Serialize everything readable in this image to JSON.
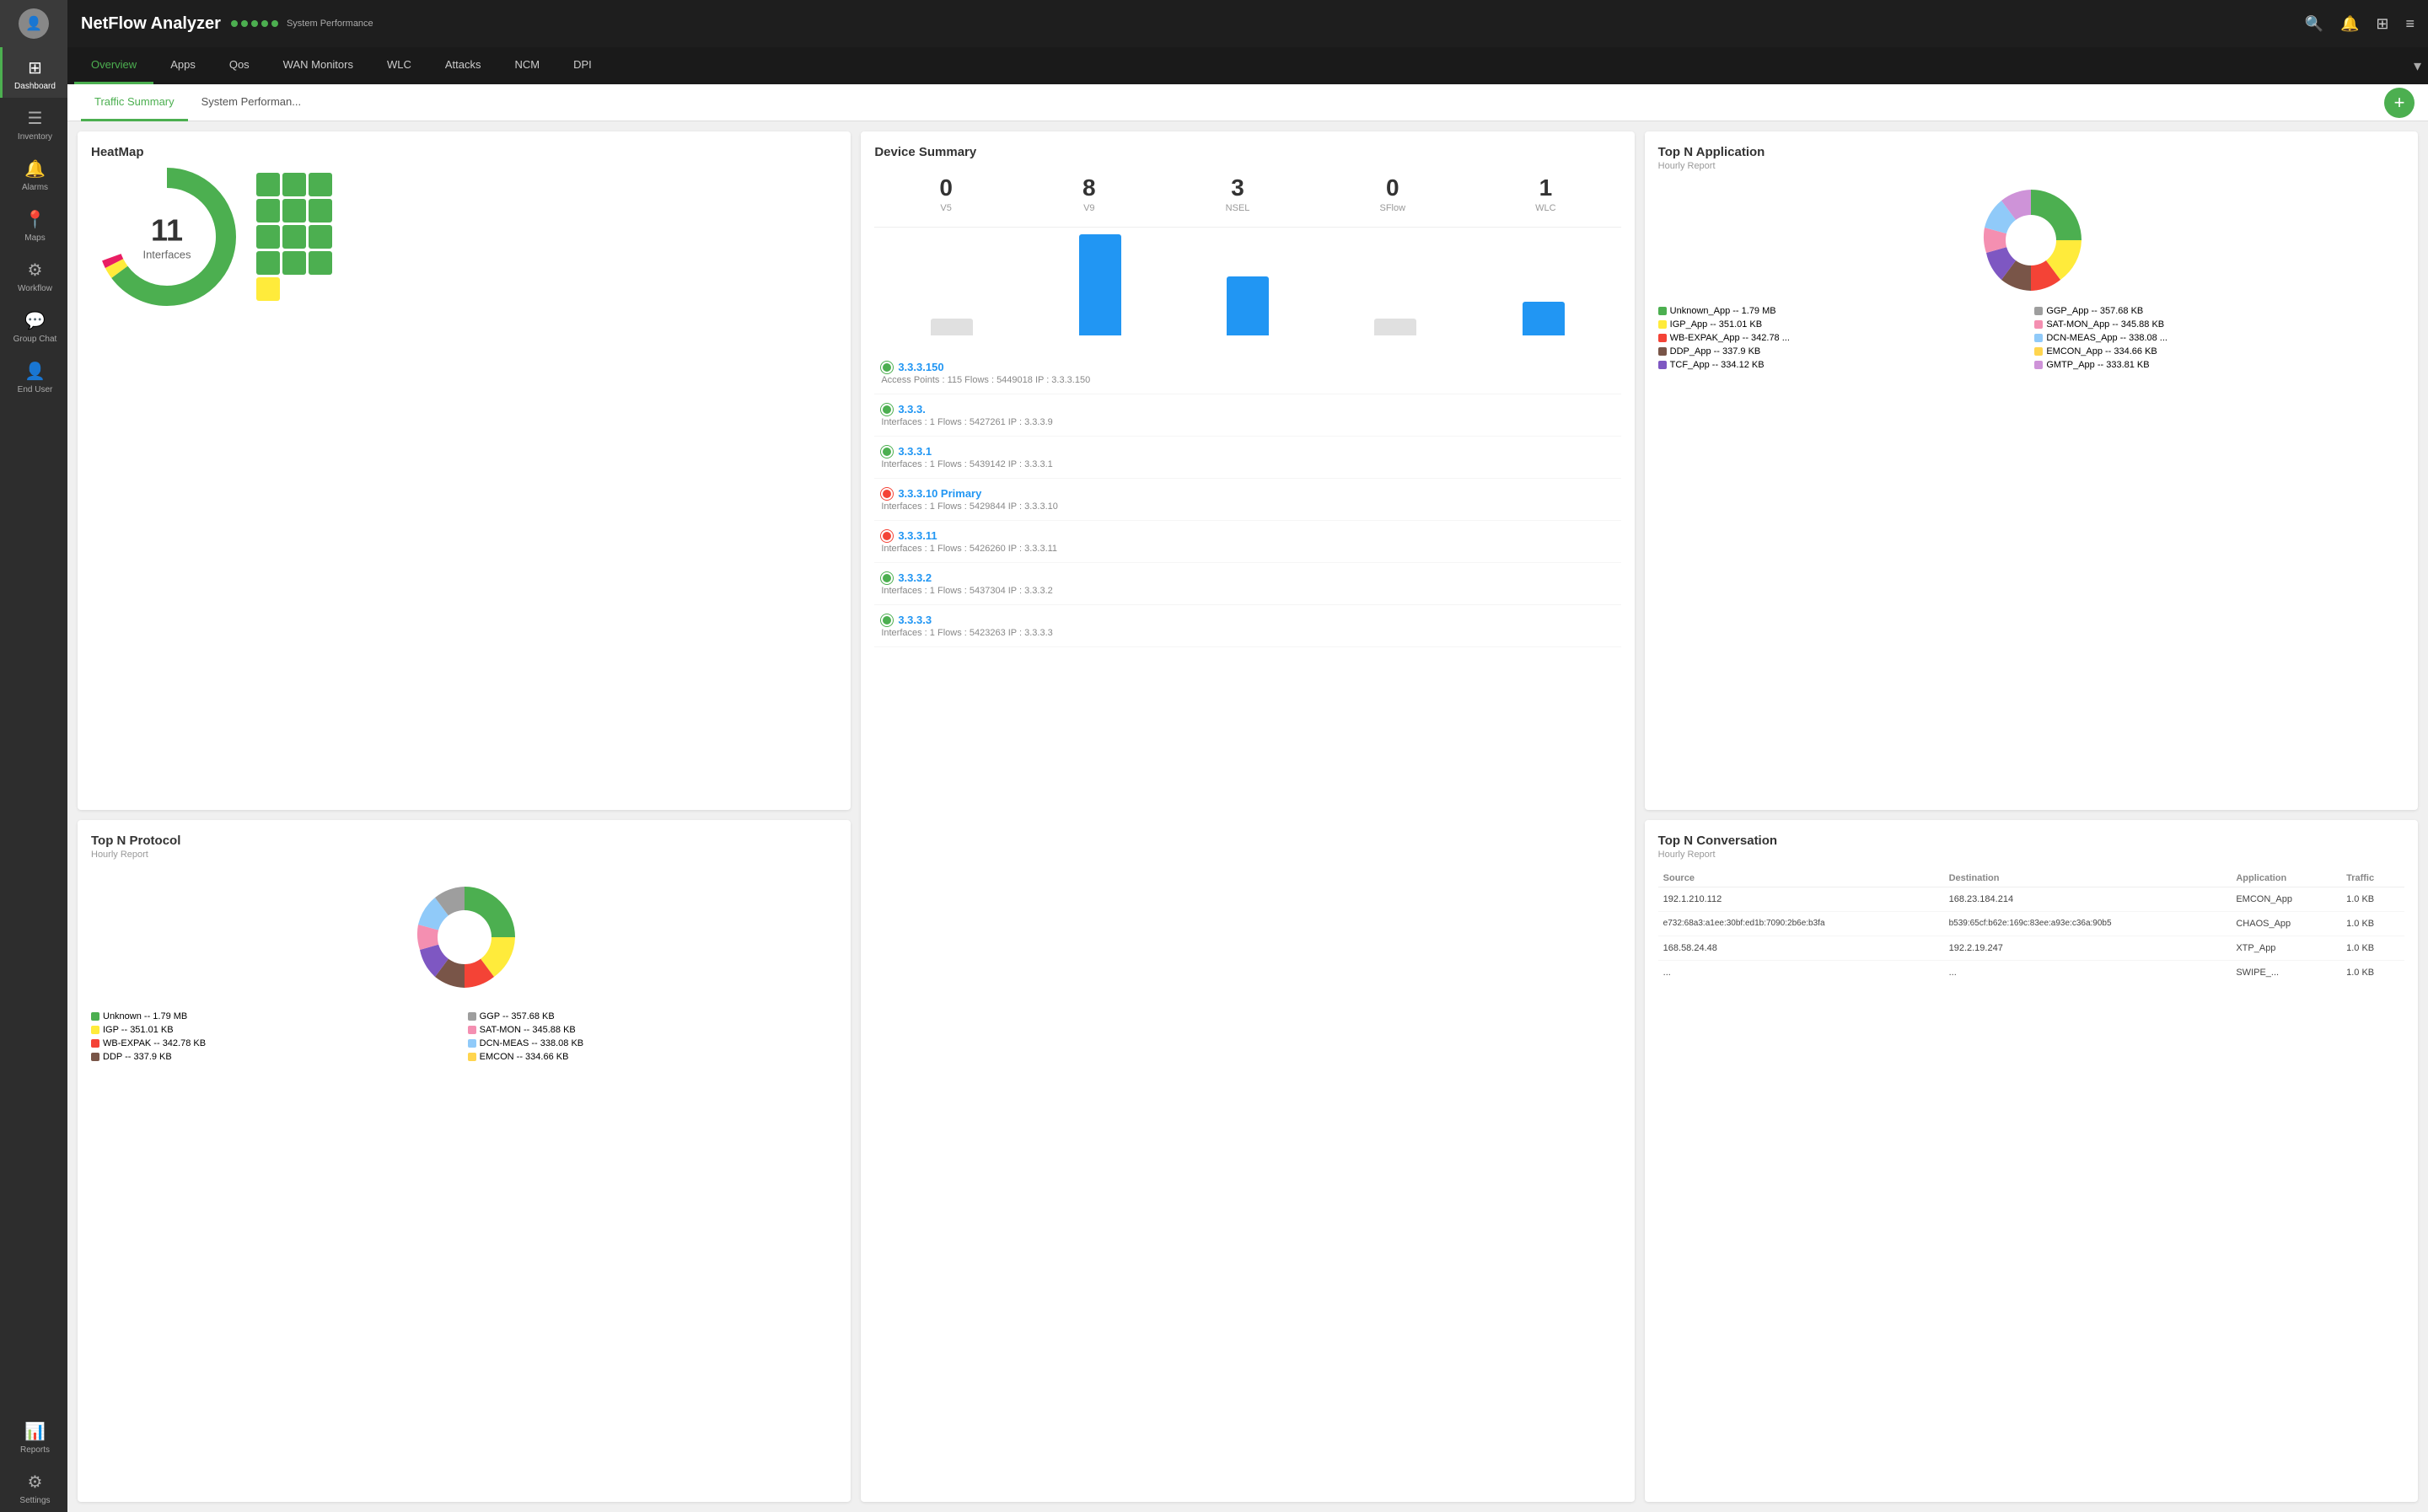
{
  "app": {
    "title": "NetFlow Analyzer",
    "status_label": "System Performance",
    "status_dots": 5
  },
  "sidebar": {
    "items": [
      {
        "id": "dashboard",
        "label": "Dashboard",
        "icon": "⊞",
        "active": true
      },
      {
        "id": "inventory",
        "label": "Inventory",
        "icon": "☰",
        "active": false
      },
      {
        "id": "alarms",
        "label": "Alarms",
        "icon": "🔔",
        "active": false
      },
      {
        "id": "maps",
        "label": "Maps",
        "icon": "📍",
        "active": false
      },
      {
        "id": "workflow",
        "label": "Workflow",
        "icon": "⚙",
        "active": false
      },
      {
        "id": "groupchat",
        "label": "Group Chat",
        "icon": "💬",
        "active": false
      },
      {
        "id": "enduser",
        "label": "End User",
        "icon": "👤",
        "active": false
      }
    ],
    "bottom_items": [
      {
        "id": "reports",
        "label": "Reports",
        "icon": "📊"
      },
      {
        "id": "settings",
        "label": "Settings",
        "icon": "⚙"
      }
    ]
  },
  "navtabs": {
    "items": [
      {
        "id": "overview",
        "label": "Overview",
        "active": true
      },
      {
        "id": "apps",
        "label": "Apps",
        "active": false
      },
      {
        "id": "qos",
        "label": "Qos",
        "active": false
      },
      {
        "id": "wan",
        "label": "WAN Monitors",
        "active": false
      },
      {
        "id": "wlc",
        "label": "WLC",
        "active": false
      },
      {
        "id": "attacks",
        "label": "Attacks",
        "active": false
      },
      {
        "id": "ncm",
        "label": "NCM",
        "active": false
      },
      {
        "id": "dpi",
        "label": "DPI",
        "active": false
      }
    ]
  },
  "subtabs": {
    "items": [
      {
        "id": "traffic",
        "label": "Traffic Summary",
        "active": true
      },
      {
        "id": "system",
        "label": "System Performan...",
        "active": false
      }
    ]
  },
  "heatmap": {
    "title": "HeatMap",
    "count": "11",
    "count_label": "Interfaces",
    "cells": [
      "green",
      "green",
      "green",
      "green",
      "green",
      "green",
      "green",
      "green",
      "green",
      "green",
      "green",
      "green",
      "green",
      "yellow",
      "empty",
      "empty",
      "empty",
      "empty"
    ]
  },
  "device_summary": {
    "title": "Device Summary",
    "stats": [
      {
        "label": "V5",
        "value": "0"
      },
      {
        "label": "V9",
        "value": "8"
      },
      {
        "label": "NSEL",
        "value": "3"
      },
      {
        "label": "SFlow",
        "value": "0"
      },
      {
        "label": "WLC",
        "value": "1"
      }
    ],
    "bars": [
      {
        "height": 20,
        "blue": false
      },
      {
        "height": 120,
        "blue": true
      },
      {
        "height": 70,
        "blue": true
      },
      {
        "height": 20,
        "blue": false
      },
      {
        "height": 40,
        "blue": true
      }
    ],
    "devices": [
      {
        "name": "3.3.3.150",
        "status": "green",
        "meta": "Access Points : 115   Flows : 5449018   IP : 3.3.3.150"
      },
      {
        "name": "3.3.3.",
        "status": "green",
        "meta": "Interfaces : 1   Flows : 5427261   IP : 3.3.3.9"
      },
      {
        "name": "3.3.3.1",
        "status": "green",
        "meta": "Interfaces : 1   Flows : 5439142   IP : 3.3.3.1"
      },
      {
        "name": "3.3.3.10 Primary",
        "status": "red",
        "meta": "Interfaces : 1   Flows : 5429844   IP : 3.3.3.10"
      },
      {
        "name": "3.3.3.11",
        "status": "red",
        "meta": "Interfaces : 1   Flows : 5426260   IP : 3.3.3.11"
      },
      {
        "name": "3.3.3.2",
        "status": "green",
        "meta": "Interfaces : 1   Flows : 5437304   IP : 3.3.3.2"
      },
      {
        "name": "3.3.3.3",
        "status": "green",
        "meta": "Interfaces : 1   Flows : 5423263   IP : 3.3.3.3"
      }
    ]
  },
  "topn_app": {
    "title": "Top N Application",
    "subtitle": "Hourly Report",
    "legend": [
      {
        "color": "#4caf50",
        "label": "Unknown_App -- 1.79 MB"
      },
      {
        "color": "#9e9e9e",
        "label": "GGP_App -- 357.68 KB"
      },
      {
        "color": "#ffeb3b",
        "label": "IGP_App -- 351.01 KB"
      },
      {
        "color": "#f48fb1",
        "label": "SAT-MON_App -- 345.88 KB"
      },
      {
        "color": "#f44336",
        "label": "WB-EXPAK_App -- 342.78 ..."
      },
      {
        "color": "#90caf9",
        "label": "DCN-MEAS_App -- 338.08 ..."
      },
      {
        "color": "#795548",
        "label": "DDP_App -- 337.9 KB"
      },
      {
        "color": "#ffd54f",
        "label": "EMCON_App -- 334.66 KB"
      },
      {
        "color": "#7e57c2",
        "label": "TCF_App -- 334.12 KB"
      },
      {
        "color": "#ce93d8",
        "label": "GMTP_App -- 333.81 KB"
      }
    ]
  },
  "topn_proto": {
    "title": "Top N Protocol",
    "subtitle": "Hourly Report",
    "legend": [
      {
        "color": "#4caf50",
        "label": "Unknown -- 1.79 MB"
      },
      {
        "color": "#9e9e9e",
        "label": "GGP -- 357.68 KB"
      },
      {
        "color": "#ffeb3b",
        "label": "IGP -- 351.01 KB"
      },
      {
        "color": "#f48fb1",
        "label": "SAT-MON -- 345.88 KB"
      },
      {
        "color": "#f44336",
        "label": "WB-EXPAK -- 342.78 KB"
      },
      {
        "color": "#90caf9",
        "label": "DCN-MEAS -- 338.08 KB"
      },
      {
        "color": "#795548",
        "label": "DDP -- 337.9 KB"
      },
      {
        "color": "#ffd54f",
        "label": "EMCON -- 334.66 KB"
      }
    ]
  },
  "topn_conv": {
    "title": "Top N Conversation",
    "subtitle": "Hourly Report",
    "headers": [
      "Source",
      "Destination",
      "Application",
      "Traffic"
    ],
    "rows": [
      {
        "source": "192.1.210.112",
        "dest": "168.23.184.214",
        "app": "EMCON_App",
        "traffic": "1.0 KB"
      },
      {
        "source": "e732:68a3:a1ee:30bf:ed1b:7090:2b6e:b3fa",
        "dest": "b539:65cf:b62e:169c:83ee:a93e:c36a:90b5",
        "app": "CHAOS_App",
        "traffic": "1.0 KB"
      },
      {
        "source": "168.58.24.48",
        "dest": "192.2.19.247",
        "app": "XTP_App",
        "traffic": "1.0 KB"
      },
      {
        "source": "...",
        "dest": "...",
        "app": "SWIPE_...",
        "traffic": "1.0 KB"
      }
    ]
  }
}
